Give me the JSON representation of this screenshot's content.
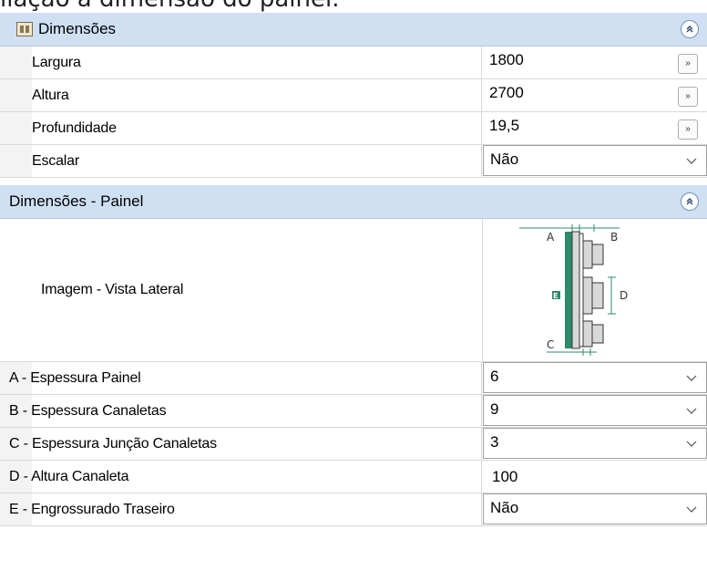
{
  "caption": "ilação a dimensão do painel.",
  "sections": {
    "dimensoes": {
      "title": "Dimensões",
      "collapse_glyph": "⌃",
      "rows": [
        {
          "label": "Largura",
          "value": "1800"
        },
        {
          "label": "Altura",
          "value": "2700"
        },
        {
          "label": "Profundidade",
          "value": "19,5"
        },
        {
          "label": "Escalar",
          "value": "Não"
        }
      ]
    },
    "painel": {
      "title": "Dimensões - Painel",
      "image_label": "Imagem - Vista Lateral",
      "diagram_labels": {
        "a": "A",
        "b": "B",
        "c": "C",
        "d": "D",
        "e": "E"
      },
      "rows": [
        {
          "label": "A - Espessura Painel",
          "value": "6"
        },
        {
          "label": "B - Espessura Canaletas",
          "value": "9"
        },
        {
          "label": "C - Espessura Junção Canaletas",
          "value": "3"
        },
        {
          "label": "D - Altura Canaleta",
          "value": "100"
        },
        {
          "label": "E - Engrossurado Traseiro",
          "value": "Não"
        }
      ]
    }
  },
  "ellipsis_glyph": "»",
  "colors": {
    "header_bg": "#cfe0f3",
    "diagram_green": "#2e8b6a"
  }
}
